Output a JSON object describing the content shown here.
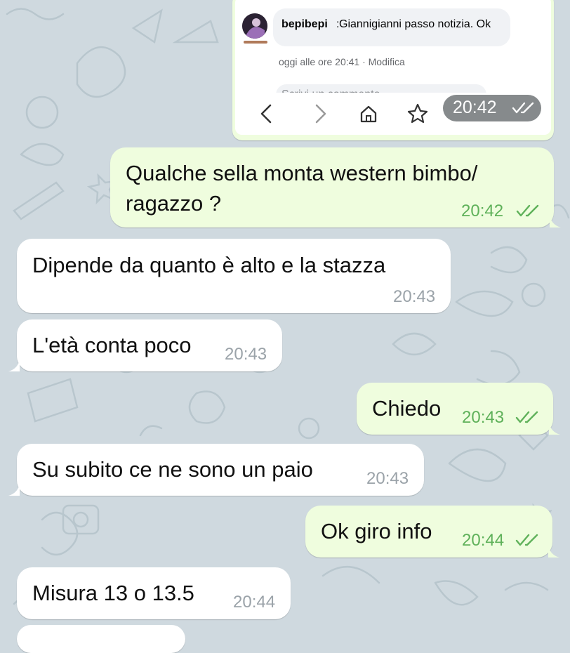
{
  "screenshot_attachment": {
    "comment": {
      "author": "bepibepi",
      "separator": ":",
      "text": " Giannigianni passo notizia. Ok"
    },
    "meta": "oggi alle ore 20:41 · Modifica",
    "input_placeholder": "Scrivi un commento...",
    "time": "20:42",
    "status": "read"
  },
  "messages": [
    {
      "direction": "out",
      "lines": [
        "Qualche sella monta western bimbo/",
        "ragazzo ?"
      ],
      "time": "20:42",
      "status": "read"
    },
    {
      "direction": "in",
      "lines": [
        "Dipende da quanto è alto e la stazza"
      ],
      "time": "20:43"
    },
    {
      "direction": "in",
      "lines": [
        "L'età conta poco"
      ],
      "time": "20:43"
    },
    {
      "direction": "out",
      "lines": [
        "Chiedo"
      ],
      "time": "20:43",
      "status": "read"
    },
    {
      "direction": "in",
      "lines": [
        "Su subito ce ne sono un paio"
      ],
      "time": "20:43"
    },
    {
      "direction": "out",
      "lines": [
        "Ok giro info"
      ],
      "time": "20:44",
      "status": "read"
    },
    {
      "direction": "in",
      "lines": [
        "Misura 13 o 13.5"
      ],
      "time": "20:44"
    }
  ],
  "colors": {
    "background": "#cfd9df",
    "incoming": "#ffffff",
    "outgoing": "#effdde",
    "outgoing_meta": "#5fb15a",
    "incoming_meta": "#9ba3a9"
  },
  "icons": [
    "back-icon",
    "forward-icon",
    "home-icon",
    "favorites-icon",
    "tabs-icon",
    "menu-icon",
    "double-check-icon"
  ]
}
